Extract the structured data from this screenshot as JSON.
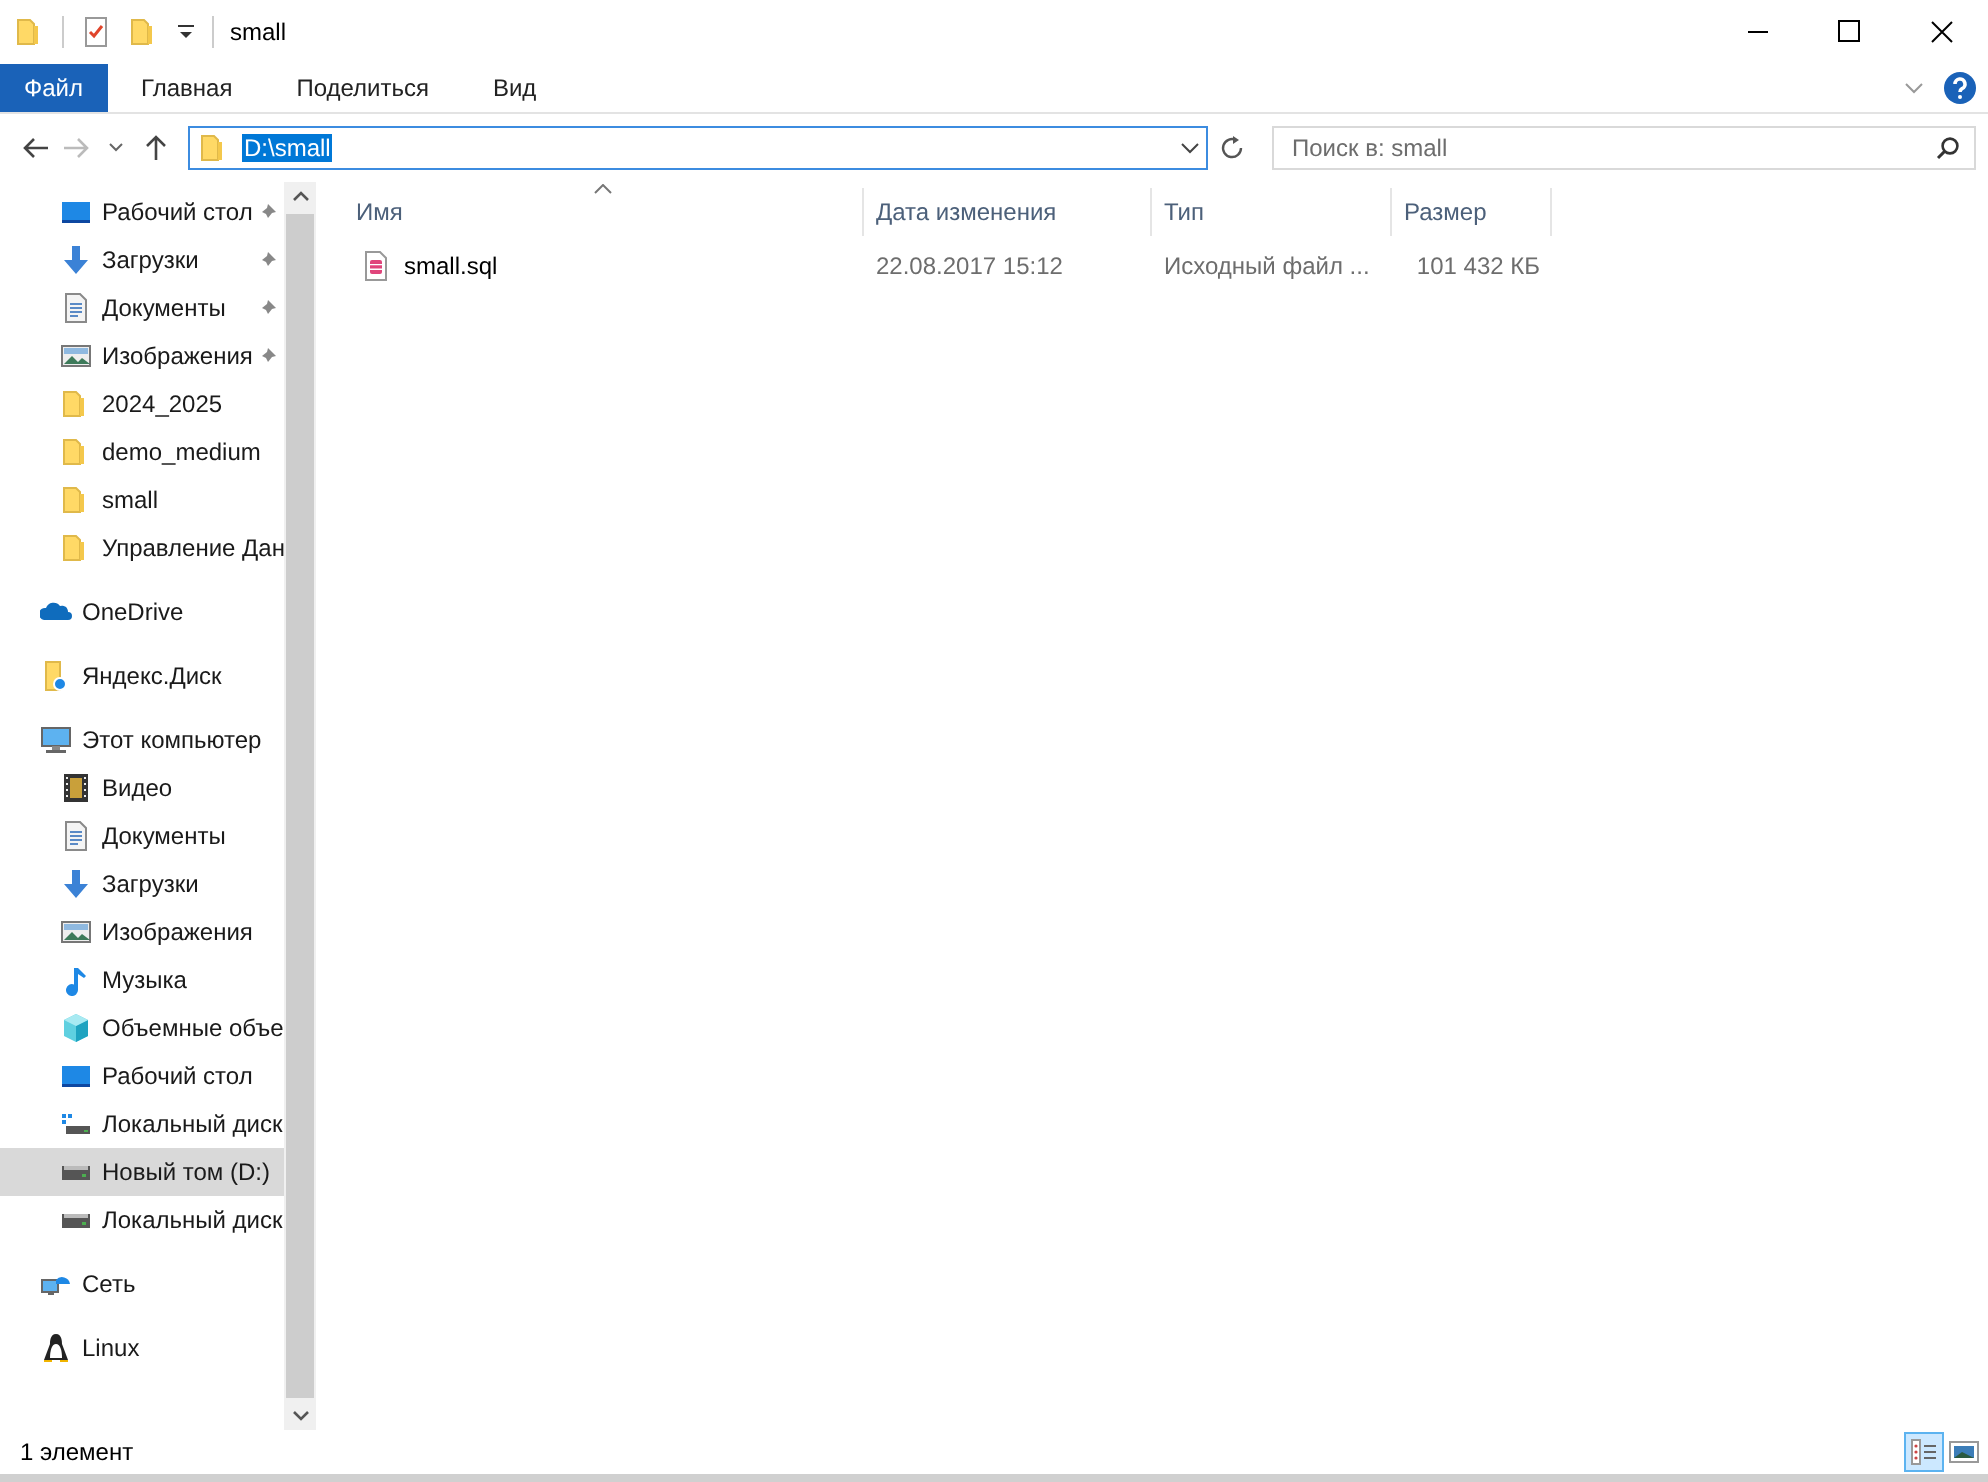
{
  "window": {
    "title": "small"
  },
  "ribbon": {
    "tabs": [
      {
        "label": "Файл",
        "kind": "file-menu"
      },
      {
        "label": "Главная",
        "kind": "tab"
      },
      {
        "label": "Поделиться",
        "kind": "tab"
      },
      {
        "label": "Вид",
        "kind": "tab"
      }
    ]
  },
  "address": {
    "path": "D:\\small",
    "selected": true
  },
  "search": {
    "placeholder": "Поиск в: small"
  },
  "nav": {
    "quick_access": [
      {
        "label": "Рабочий стол",
        "kind": "desktop",
        "pinned": true,
        "selected": false
      },
      {
        "label": "Загрузки",
        "kind": "download",
        "pinned": true,
        "selected": false
      },
      {
        "label": "Документы",
        "kind": "docs",
        "pinned": true,
        "selected": false
      },
      {
        "label": "Изображения",
        "kind": "images",
        "pinned": true,
        "selected": false
      },
      {
        "label": "2024_2025",
        "kind": "folder",
        "pinned": false,
        "selected": false
      },
      {
        "label": "demo_medium",
        "kind": "folder",
        "pinned": false,
        "selected": false
      },
      {
        "label": "small",
        "kind": "folder",
        "pinned": false,
        "selected": false
      },
      {
        "label": "Управление Дан",
        "kind": "folder",
        "pinned": false,
        "selected": false
      }
    ],
    "roots": [
      {
        "label": "OneDrive",
        "kind": "onedrive",
        "selected": false
      },
      {
        "label": "Яндекс.Диск",
        "kind": "yadisk",
        "selected": false
      },
      {
        "label": "Этот компьютер",
        "kind": "pc",
        "selected": false,
        "children": [
          {
            "label": "Видео",
            "kind": "video",
            "selected": false
          },
          {
            "label": "Документы",
            "kind": "docs",
            "selected": false
          },
          {
            "label": "Загрузки",
            "kind": "download",
            "selected": false
          },
          {
            "label": "Изображения",
            "kind": "images",
            "selected": false
          },
          {
            "label": "Музыка",
            "kind": "music",
            "selected": false
          },
          {
            "label": "Объемные объе",
            "kind": "cube",
            "selected": false
          },
          {
            "label": "Рабочий стол",
            "kind": "desktop",
            "selected": false
          },
          {
            "label": "Локальный диск",
            "kind": "drive-win",
            "selected": false
          },
          {
            "label": "Новый том (D:)",
            "kind": "drive",
            "selected": true
          },
          {
            "label": "Локальный диск",
            "kind": "drive",
            "selected": false
          }
        ]
      },
      {
        "label": "Сеть",
        "kind": "network",
        "selected": false
      },
      {
        "label": "Linux",
        "kind": "linux",
        "selected": false
      }
    ]
  },
  "table": {
    "columns": [
      {
        "label": "Имя",
        "sorted": true
      },
      {
        "label": "Дата изменения",
        "sorted": false
      },
      {
        "label": "Тип",
        "sorted": false
      },
      {
        "label": "Размер",
        "sorted": false
      }
    ],
    "rows": [
      {
        "kind": "sql",
        "cells": [
          "small.sql",
          "22.08.2017 15:12",
          "Исходный файл ...",
          "101 432 КБ"
        ],
        "selected": false
      }
    ]
  },
  "status_bar": {
    "text": "1 элемент",
    "views": [
      {
        "kind": "details",
        "selected": true
      },
      {
        "kind": "tiles",
        "selected": false
      }
    ]
  }
}
